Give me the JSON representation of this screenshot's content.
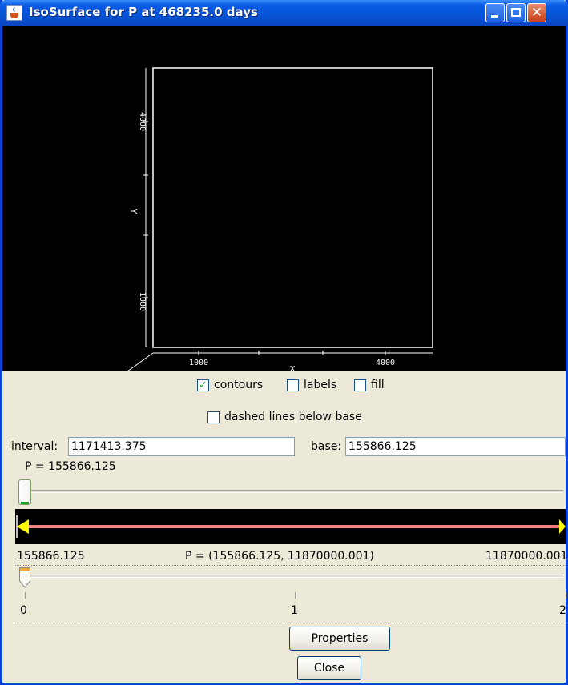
{
  "window": {
    "title": "IsoSurface for P at 468235.0 days",
    "accent_color": "#0a5be6",
    "icons": [
      "java-icon",
      "minimize-icon",
      "maximize-icon",
      "close-icon"
    ]
  },
  "plot": {
    "y_axis_label": "Y",
    "x_axis_label": "X",
    "y_ticks": [
      "1000",
      "4000"
    ],
    "x_ticks": [
      "1000",
      "4000"
    ],
    "background": "#000000",
    "frame_color": "#ffffff"
  },
  "options": {
    "contours_label": "contours",
    "contours_checked": true,
    "labels_label": "labels",
    "labels_checked": false,
    "fill_label": "fill",
    "fill_checked": false,
    "dashed_label": "dashed lines below base",
    "dashed_checked": false
  },
  "fields": {
    "interval_label": "interval:",
    "interval_value": "1171413.375",
    "base_label": "base:",
    "base_value": "155866.125"
  },
  "level_slider": {
    "label": "P = 155866.125",
    "fraction": 0.0
  },
  "range": {
    "min": "155866.125",
    "max": "11870000.001",
    "center": "P = (155866.125, 11870000.001)",
    "line_color": "#f08080",
    "arrow_color": "#ffff00"
  },
  "time_slider": {
    "ticks": [
      "0",
      "1",
      "2"
    ],
    "value": 0
  },
  "buttons": {
    "properties": "Properties",
    "close": "Close"
  }
}
